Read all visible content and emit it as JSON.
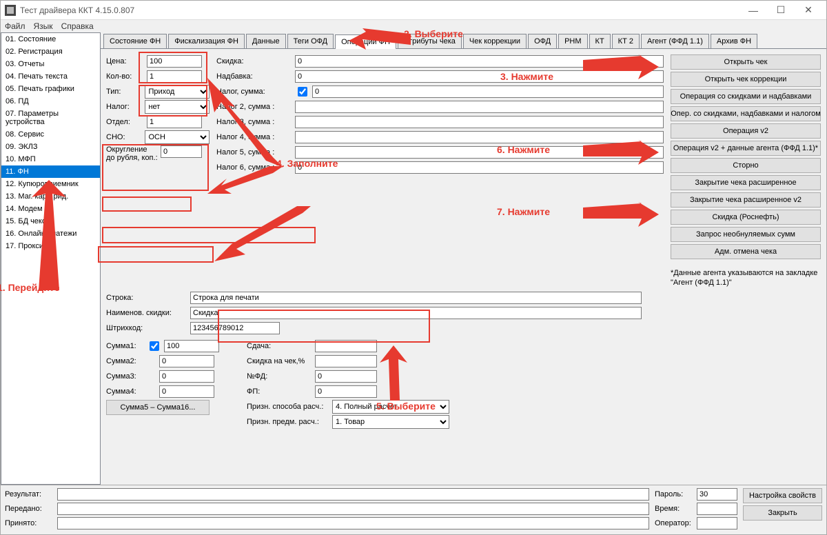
{
  "title": "Тест драйвера ККТ 4.15.0.807",
  "menu": [
    "Файл",
    "Язык",
    "Справка"
  ],
  "sidebar": {
    "items": [
      {
        "label": "01. Состояние"
      },
      {
        "label": "02. Регистрация"
      },
      {
        "label": "03. Отчеты"
      },
      {
        "label": "04. Печать текста"
      },
      {
        "label": "05. Печать графики"
      },
      {
        "label": "06. ПД"
      },
      {
        "label": "07. Параметры устройства"
      },
      {
        "label": "08. Сервис"
      },
      {
        "label": "09. ЭКЛЗ"
      },
      {
        "label": "10. МФП"
      },
      {
        "label": "11. ФН"
      },
      {
        "label": "12. Купюроприемник"
      },
      {
        "label": "13. Маг. карт. рид."
      },
      {
        "label": "14. Модем"
      },
      {
        "label": "15. БД чеков"
      },
      {
        "label": "16. Онлайн платежи"
      },
      {
        "label": "17. Прокси"
      }
    ],
    "selectedIndex": 10
  },
  "tabs": {
    "items": [
      {
        "label": "Состояние ФН"
      },
      {
        "label": "Фискализация ФН"
      },
      {
        "label": "Данные"
      },
      {
        "label": "Теги ОФД"
      },
      {
        "label": "Операции ФН"
      },
      {
        "label": "Атрибуты чека"
      },
      {
        "label": "Чек коррекции"
      },
      {
        "label": "ОФД"
      },
      {
        "label": "РНМ"
      },
      {
        "label": "КТ"
      },
      {
        "label": "КТ 2"
      },
      {
        "label": "Агент (ФФД 1.1)"
      },
      {
        "label": "Архив ФН"
      }
    ],
    "activeIndex": 4
  },
  "form": {
    "price_label": "Цена:",
    "price": "100",
    "qty_label": "Кол-во:",
    "qty": "1",
    "type_label": "Тип:",
    "type": "Приход",
    "tax_label": "Налог:",
    "tax": "нет",
    "dept_label": "Отдел:",
    "dept": "1",
    "sno_label": "СНО:",
    "sno": "ОСН",
    "round_label": "Округление до рубля, коп.:",
    "round": "0",
    "discount_label": "Скидка:",
    "discount": "0",
    "surcharge_label": "Надбавка:",
    "surcharge": "0",
    "tax_sum_label": "Налог, сумма:",
    "tax_sum": "0",
    "tax2_label": "Налог 2, сумма :",
    "tax2": "",
    "tax3_label": "Налог 3, сумма :",
    "tax3": "",
    "tax4_label": "Налог 4, сумма :",
    "tax4": "",
    "tax5_label": "Налог 5, сумма :",
    "tax5": "",
    "tax6_label": "Налог 6, сумма :",
    "tax6": "0",
    "string_label": "Строка:",
    "string": "Строка для печати",
    "dname_label": "Наименов. скидки:",
    "dname": "Скидка",
    "barcode_label": "Штрихкод:",
    "barcode": "123456789012",
    "sum1_label": "Сумма1:",
    "sum1": "100",
    "sum2_label": "Сумма2:",
    "sum2": "0",
    "sum3_label": "Сумма3:",
    "sum3": "0",
    "sum4_label": "Сумма4:",
    "sum4": "0",
    "sum5btn": "Сумма5 – Сумма16...",
    "change_label": "Сдача:",
    "checkdisc_label": "Скидка на чек,%",
    "fd_label": "№ФД:",
    "fd": "0",
    "fp_label": "ФП:",
    "fp": "0",
    "paymethod_label": "Призн. способа расч.:",
    "paymethod": "4. Полный расчет",
    "paysubj_label": "Призн. предм. расч.:",
    "paysubj": "1. Товар"
  },
  "actions": {
    "open": "Открыть чек",
    "open_corr": "Открыть чек коррекции",
    "op_disc": "Операция со скидками и надбавками",
    "op_disc_tax": "Опер. со скидками, надбавками и налогом",
    "op_v2": "Операция v2",
    "op_v2_agent": "Операция v2 + данные агента (ФФД 1.1)*",
    "storno": "Сторно",
    "close_ext": "Закрытие чека расширенное",
    "close_ext_v2": "Закрытие чека расширенное v2",
    "rosneft": "Скидка (Роснефть)",
    "nonzero": "Запрос необнуляемых сумм",
    "adm_cancel": "Адм. отмена чека",
    "agent_note": "*Данные агента указываются на закладке \"Агент (ФФД 1.1)\""
  },
  "footer": {
    "result_label": "Результат:",
    "result": "",
    "sent_label": "Передано:",
    "sent": "",
    "recv_label": "Принято:",
    "recv": "",
    "pass_label": "Пароль:",
    "pass": "30",
    "time_label": "Время:",
    "time": "",
    "operator_label": "Оператор:",
    "operator": "",
    "settings": "Настройка свойств",
    "close": "Закрыть"
  },
  "annotations": {
    "a1": "1. Перейдите",
    "a2": "2. Выберите",
    "a3": "3. Нажмите",
    "a4": "4. Заполните",
    "a5": "5. Выберите",
    "a6": "6. Нажмите",
    "a7": "7. Нажмите"
  }
}
